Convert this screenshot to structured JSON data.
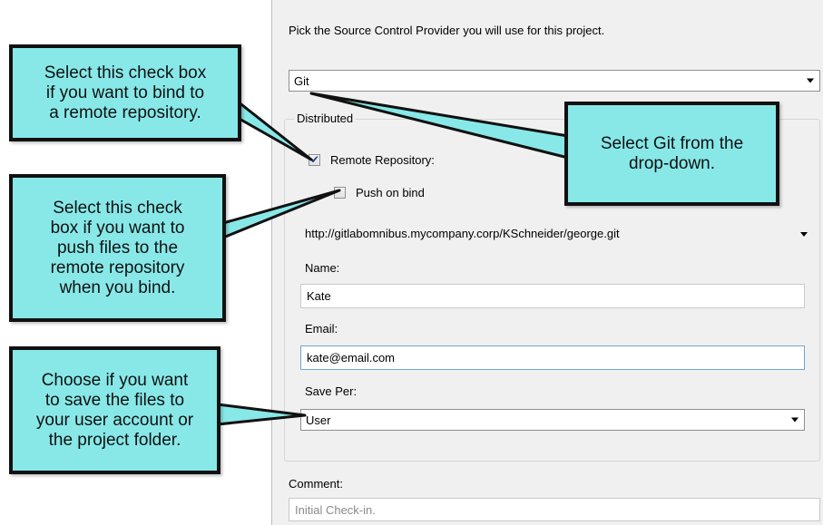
{
  "dialog": {
    "intro": "Pick the Source Control Provider you will use for this project.",
    "provider_select": {
      "value": "Git"
    },
    "group_label": "Distributed",
    "remote_repository": {
      "label": "Remote Repository:",
      "checked": true
    },
    "push_on_bind": {
      "label": "Push on bind",
      "checked": false
    },
    "repo_url_select": {
      "value": "http://gitlabomnibus.mycompany.corp/KSchneider/george.git"
    },
    "name": {
      "label": "Name:",
      "value": "Kate"
    },
    "email": {
      "label": "Email:",
      "value": "kate@email.com"
    },
    "save_per": {
      "label": "Save Per:",
      "value": "User"
    },
    "comment": {
      "label": "Comment:",
      "value": "Initial Check-in."
    }
  },
  "callouts": {
    "remote": "Select this check box\nif you want to bind to\na remote repository.",
    "git": "Select Git from the\ndrop-down.",
    "push": "Select this check\nbox if you want to\npush files to the\nremote repository\nwhen you bind.",
    "save": "Choose if you want\nto save the files to\nyour user account or\nthe project folder."
  },
  "colors": {
    "callout_fill": "#88e8e8",
    "callout_border": "#111111",
    "dialog_bg": "#f0f0f0"
  }
}
